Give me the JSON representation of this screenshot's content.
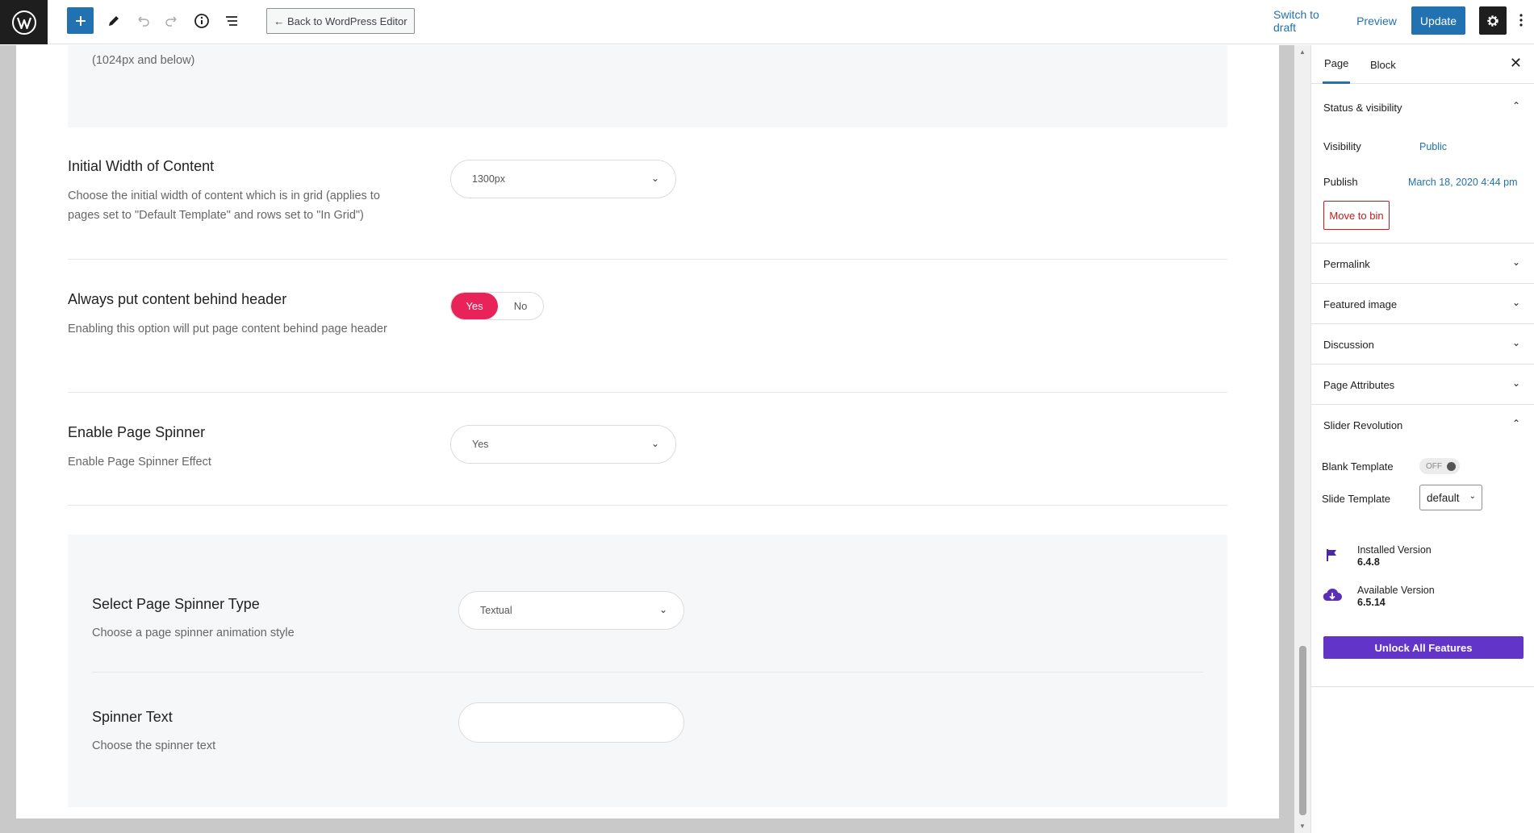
{
  "toolbar": {
    "add_icon": "plus-icon",
    "back_label": "← Back to WordPress Editor",
    "switch_draft": "Switch to draft",
    "preview": "Preview",
    "update": "Update"
  },
  "editor": {
    "breakpoint_note": "(1024px and below)",
    "options": [
      {
        "title": "Initial Width of Content",
        "desc": "Choose the initial width of content which is in grid (applies to pages set to \"Default Template\" and rows set to \"In Grid\")",
        "value": "1300px"
      },
      {
        "title": "Always put content behind header",
        "desc": "Enabling this option will put page content behind page header",
        "yes": "Yes",
        "no": "No"
      },
      {
        "title": "Enable Page Spinner",
        "desc": "Enable Page Spinner Effect",
        "value": "Yes"
      },
      {
        "title": "Select Page Spinner Type",
        "desc": "Choose a page spinner animation style",
        "value": "Textual"
      },
      {
        "title": "Spinner Text",
        "desc": "Choose the spinner text",
        "value": ""
      }
    ]
  },
  "sidebar": {
    "tabs": [
      "Page",
      "Block"
    ],
    "status": {
      "title": "Status & visibility",
      "visibility_label": "Visibility",
      "visibility_value": "Public",
      "publish_label": "Publish",
      "publish_value": "March 18, 2020 4:44 pm",
      "move_to_bin": "Move to bin"
    },
    "panels": [
      "Permalink",
      "Featured image",
      "Discussion",
      "Page Attributes"
    ],
    "slider": {
      "title": "Slider Revolution",
      "blank_label": "Blank Template",
      "blank_state": "OFF",
      "slide_label": "Slide Template",
      "slide_value": "default",
      "installed_label": "Installed Version",
      "installed_value": "6.4.8",
      "available_label": "Available Version",
      "available_value": "6.5.14",
      "unlock": "Unlock All Features"
    }
  },
  "colors": {
    "accent": "#2271b1",
    "toggle_yes": "#e8235a",
    "slider_purple": "#6235c8",
    "danger": "#cc1818"
  }
}
